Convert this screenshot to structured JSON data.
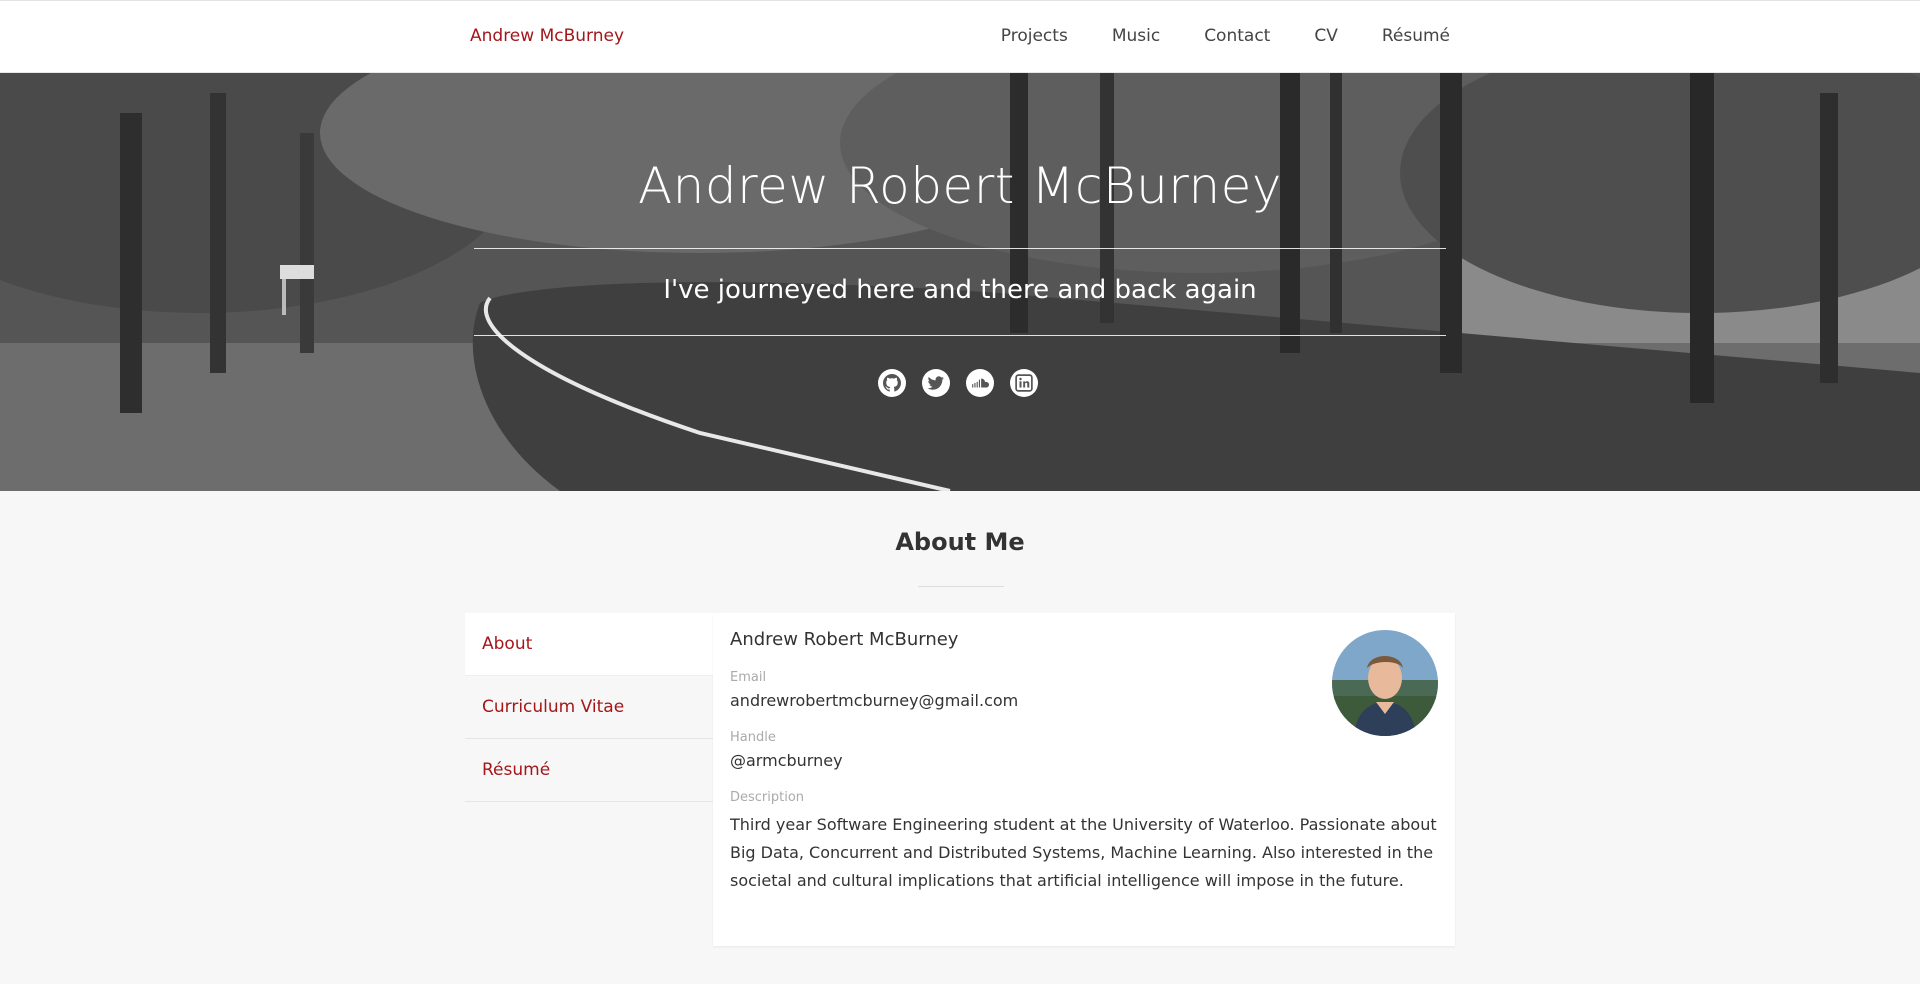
{
  "navbar": {
    "brand": "Andrew McBurney",
    "links": [
      "Projects",
      "Music",
      "Contact",
      "CV",
      "Résumé"
    ]
  },
  "hero": {
    "title": "Andrew Robert McBurney",
    "subtitle": "I've journeyed here and there and back again",
    "socials": [
      "github-icon",
      "twitter-icon",
      "soundcloud-icon",
      "linkedin-icon"
    ]
  },
  "about": {
    "heading": "About Me",
    "tabs": [
      "About",
      "Curriculum Vitae",
      "Résumé"
    ],
    "card": {
      "name": "Andrew Robert McBurney",
      "email_label": "Email",
      "email": "andrewrobertmcburney@gmail.com",
      "handle_label": "Handle",
      "handle": "@armcburney",
      "description_label": "Description",
      "description": "Third year Software Engineering student at the University of Waterloo. Passionate about Big Data, Concurrent and Distributed Systems, Machine Learning. Also interested in the societal and cultural implications that artificial intelligence will impose in the future."
    }
  },
  "colors": {
    "accent": "#a3171b",
    "background": "#f7f7f7"
  }
}
